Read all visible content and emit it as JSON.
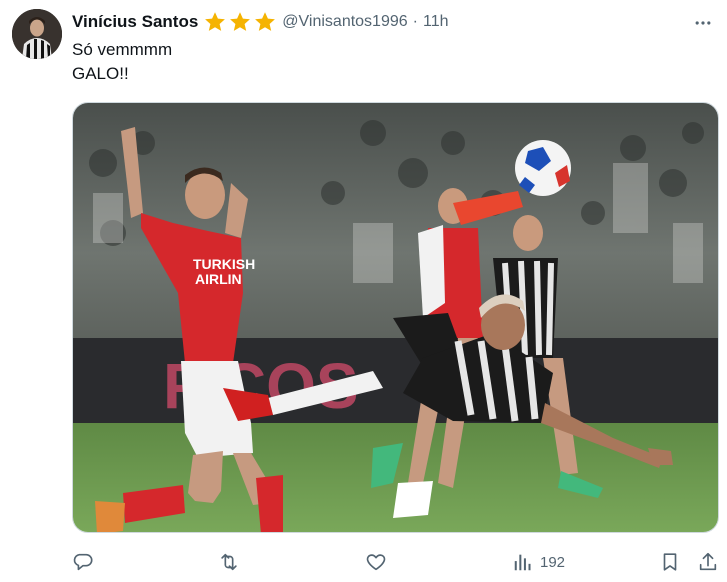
{
  "tweet": {
    "author_name": "Vinícius Santos",
    "handle": "@Vinisantos1996",
    "separator": "·",
    "time": "11h",
    "text_lines": [
      "Só vemmmm",
      "GALO!!"
    ],
    "verified_icons": [
      "star-icon",
      "star-icon",
      "star-icon"
    ],
    "star_color": "#f5b301"
  },
  "media": {
    "banner_text": "FICOS"
  },
  "actions": {
    "reply_icon": "reply-icon",
    "retweet_icon": "retweet-icon",
    "like_icon": "heart-icon",
    "views_icon": "views-icon",
    "views_count": "192",
    "bookmark_icon": "bookmark-icon",
    "share_icon": "share-icon"
  }
}
